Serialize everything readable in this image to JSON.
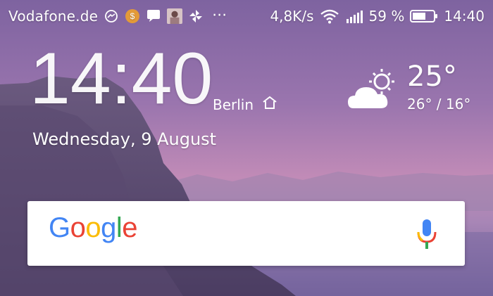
{
  "status_bar": {
    "carrier": "Vodafone.de",
    "netspeed": "4,8K/s",
    "battery_pct": "59 %",
    "time": "14:40",
    "notification_icons": [
      "messenger-icon",
      "coin-icon",
      "chat-bubble-icon",
      "photo-thumbnail-icon",
      "pinwheel-icon"
    ],
    "more": "···"
  },
  "clock_widget": {
    "time": "14:40",
    "city": "Berlin",
    "date": "Wednesday, 9 August"
  },
  "weather_widget": {
    "icon": "partly-cloudy-icon",
    "temperature": "25°",
    "range": "26° / 16°"
  },
  "search_widget": {
    "logo": "Google",
    "colors": {
      "blue": "#4285F4",
      "red": "#EA4335",
      "yellow": "#FBBC05",
      "green": "#34A853"
    },
    "mic_icon": "microphone-icon"
  }
}
